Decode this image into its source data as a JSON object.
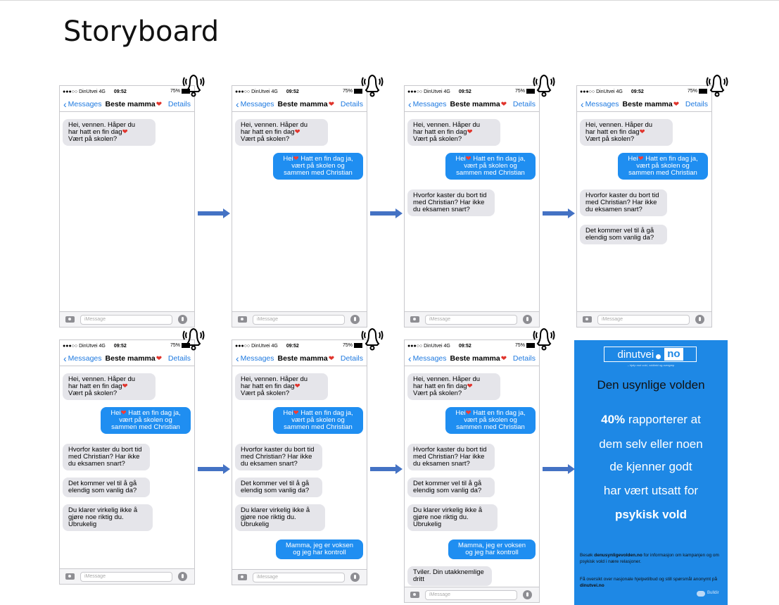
{
  "title": "Storyboard",
  "status": {
    "carrier": "●●●○○ DinUtvei  4G",
    "time": "09:52",
    "battery": "75%"
  },
  "nav": {
    "back": "Messages",
    "contact": "Beste mamma",
    "heart": "❤",
    "details": "Details"
  },
  "input_placeholder": "iMessage",
  "messages": {
    "m1a": "Hei, vennen. Håper du",
    "m1b": "har hatt en fin dag",
    "m1c": "Vært på skolen?",
    "m2a": "Hei",
    "m2b": " Hatt en fin dag ja,",
    "m2c": "vært på skolen og",
    "m2d": "sammen med Christian",
    "m3": "Hvorfor kaster du bort tid med Christian? Har ikke du eksamen snart?",
    "m4": "Det kommer vel til å gå elendig som vanlig da?",
    "m5": "Du klarer virkelig ikke å gjøre noe riktig du. Ubrukelig",
    "m6": "Mamma, jeg er voksen og jeg har kontroll",
    "m7": "Tviler. Din utakknemlige dritt"
  },
  "poster": {
    "logo_left": "dinutvei",
    "logo_right": "no",
    "tagline": "– hjelp mot vold, voldtekt og overgrep",
    "headline": "Den usynlige volden",
    "stat_number": "40%",
    "stat_text": " rapporterer at",
    "line2": "dem selv eller noen",
    "line3": "de kjenner godt",
    "line4": "har vært utsatt for",
    "line5": "psykisk vold",
    "info1_prefix": "Besøk ",
    "info1_link": "denusynligevolden.no",
    "info1_suffix": " for informasjon om kampanjen og om psykisk vold i nære relasjoner.",
    "info2_prefix": "Få oversikt over nasjonale hjelpetilbud og still spørsmål anonymt på ",
    "info2_link": "dinutvei.no",
    "toggle_label": "Bulldir"
  },
  "colors": {
    "ios_blue": "#1f8ef1",
    "link_blue": "#1f7ae0",
    "incoming_gray": "#e5e5ea",
    "poster_blue": "#1e88e5",
    "arrow_blue": "#4472c4",
    "heart_red": "#e0342c"
  }
}
